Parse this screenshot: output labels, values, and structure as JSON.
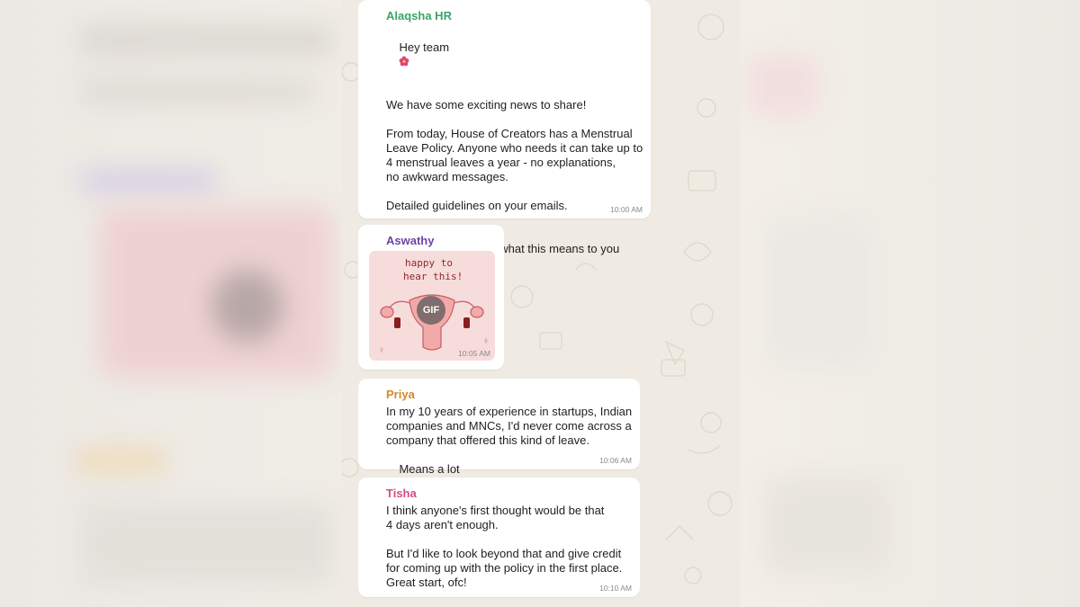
{
  "chat": {
    "messages": [
      {
        "sender": "Alaqsha HR",
        "sender_color": "#3aa56b",
        "lines": [
          "Hey team",
          "",
          "We have some exciting news to share!",
          "",
          "From today, House of Creators has a Menstrual",
          "Leave Policy. Anyone who needs it can take up to",
          "4 menstrual leaves a year - no explanations,",
          "no awkward messages.",
          "",
          "Detailed guidelines on your emails.",
          "",
          "Would love to hear what this means to you"
        ],
        "time": "10:00 AM"
      },
      {
        "sender": "Aswathy",
        "sender_color": "#6b46a3",
        "gif": {
          "caption_line1": "happy to",
          "caption_line2": "hear this!",
          "badge": "GIF"
        },
        "time": "10:05 AM"
      },
      {
        "sender": "Priya",
        "sender_color": "#d4892a",
        "lines": [
          "In my 10 years of experience in startups, Indian",
          "companies and MNCs, I'd never come across a",
          "company that offered this kind of leave.",
          "Means a lot"
        ],
        "time": "10:06 AM"
      },
      {
        "sender": "Tisha",
        "sender_color": "#d64b86",
        "lines": [
          "I think anyone's first thought would be that",
          "4 days aren't enough.",
          "",
          "But I'd like to look beyond that and give credit",
          "for coming up with the policy in the first place.",
          "Great start, ofc!"
        ],
        "time": "10:10 AM"
      }
    ]
  },
  "icons": {
    "flower": "flower-icon",
    "heart": "heart-icon"
  },
  "colors": {
    "chat_background": "#efeae2",
    "bubble": "#ffffff",
    "heart": "#e0245e"
  }
}
